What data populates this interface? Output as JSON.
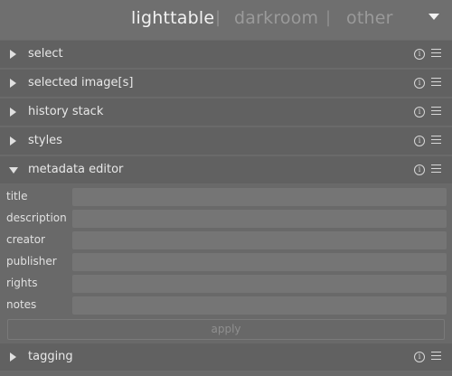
{
  "views": {
    "lighttable": "lighttable",
    "darkroom": "darkroom",
    "other": "other",
    "separator": "|"
  },
  "modules": [
    {
      "title": "select",
      "expanded": false
    },
    {
      "title": "selected image[s]",
      "expanded": false
    },
    {
      "title": "history stack",
      "expanded": false
    },
    {
      "title": "styles",
      "expanded": false
    },
    {
      "title": "metadata editor",
      "expanded": true
    },
    {
      "title": "tagging",
      "expanded": false
    }
  ],
  "icons": {
    "info": "info-icon",
    "menu": "hamburger-menu-icon"
  },
  "metadata_editor": {
    "fields": [
      {
        "label": "title",
        "value": ""
      },
      {
        "label": "description",
        "value": ""
      },
      {
        "label": "creator",
        "value": ""
      },
      {
        "label": "publisher",
        "value": ""
      },
      {
        "label": "rights",
        "value": ""
      },
      {
        "label": "notes",
        "value": ""
      }
    ],
    "apply_label": "apply"
  },
  "glyphs": {
    "info": "i"
  }
}
